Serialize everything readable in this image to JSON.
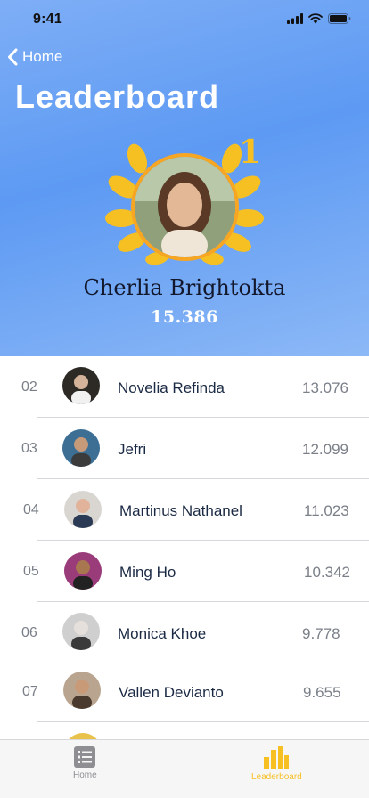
{
  "status_bar": {
    "time": "9:41"
  },
  "nav": {
    "back_label": "Home"
  },
  "header": {
    "title": "Leaderboard"
  },
  "winner": {
    "rank": "1",
    "name": "Cherlia Brightokta",
    "score": "15.386"
  },
  "rankings": [
    {
      "rank": "02",
      "name": "Novelia Refinda",
      "score": "13.076"
    },
    {
      "rank": "03",
      "name": "Jefri",
      "score": "12.099"
    },
    {
      "rank": "04",
      "name": "Martinus Nathanel",
      "score": "11.023"
    },
    {
      "rank": "05",
      "name": "Ming Ho",
      "score": "10.342"
    },
    {
      "rank": "06",
      "name": "Monica Khoe",
      "score": "9.778"
    },
    {
      "rank": "07",
      "name": "Vallen Devianto",
      "score": "9.655"
    }
  ],
  "tab_bar": {
    "tabs": [
      {
        "label": "Home",
        "icon": "list-icon",
        "active": false
      },
      {
        "label": "Leaderboard",
        "icon": "bar-chart-icon",
        "active": true
      }
    ]
  },
  "colors": {
    "hero_gradient_start": "#7eaef6",
    "hero_gradient_end": "#5d9af3",
    "accent_gold": "#f6c022",
    "active_tab": "#f6c022",
    "inactive_tab": "#8e8e93"
  }
}
